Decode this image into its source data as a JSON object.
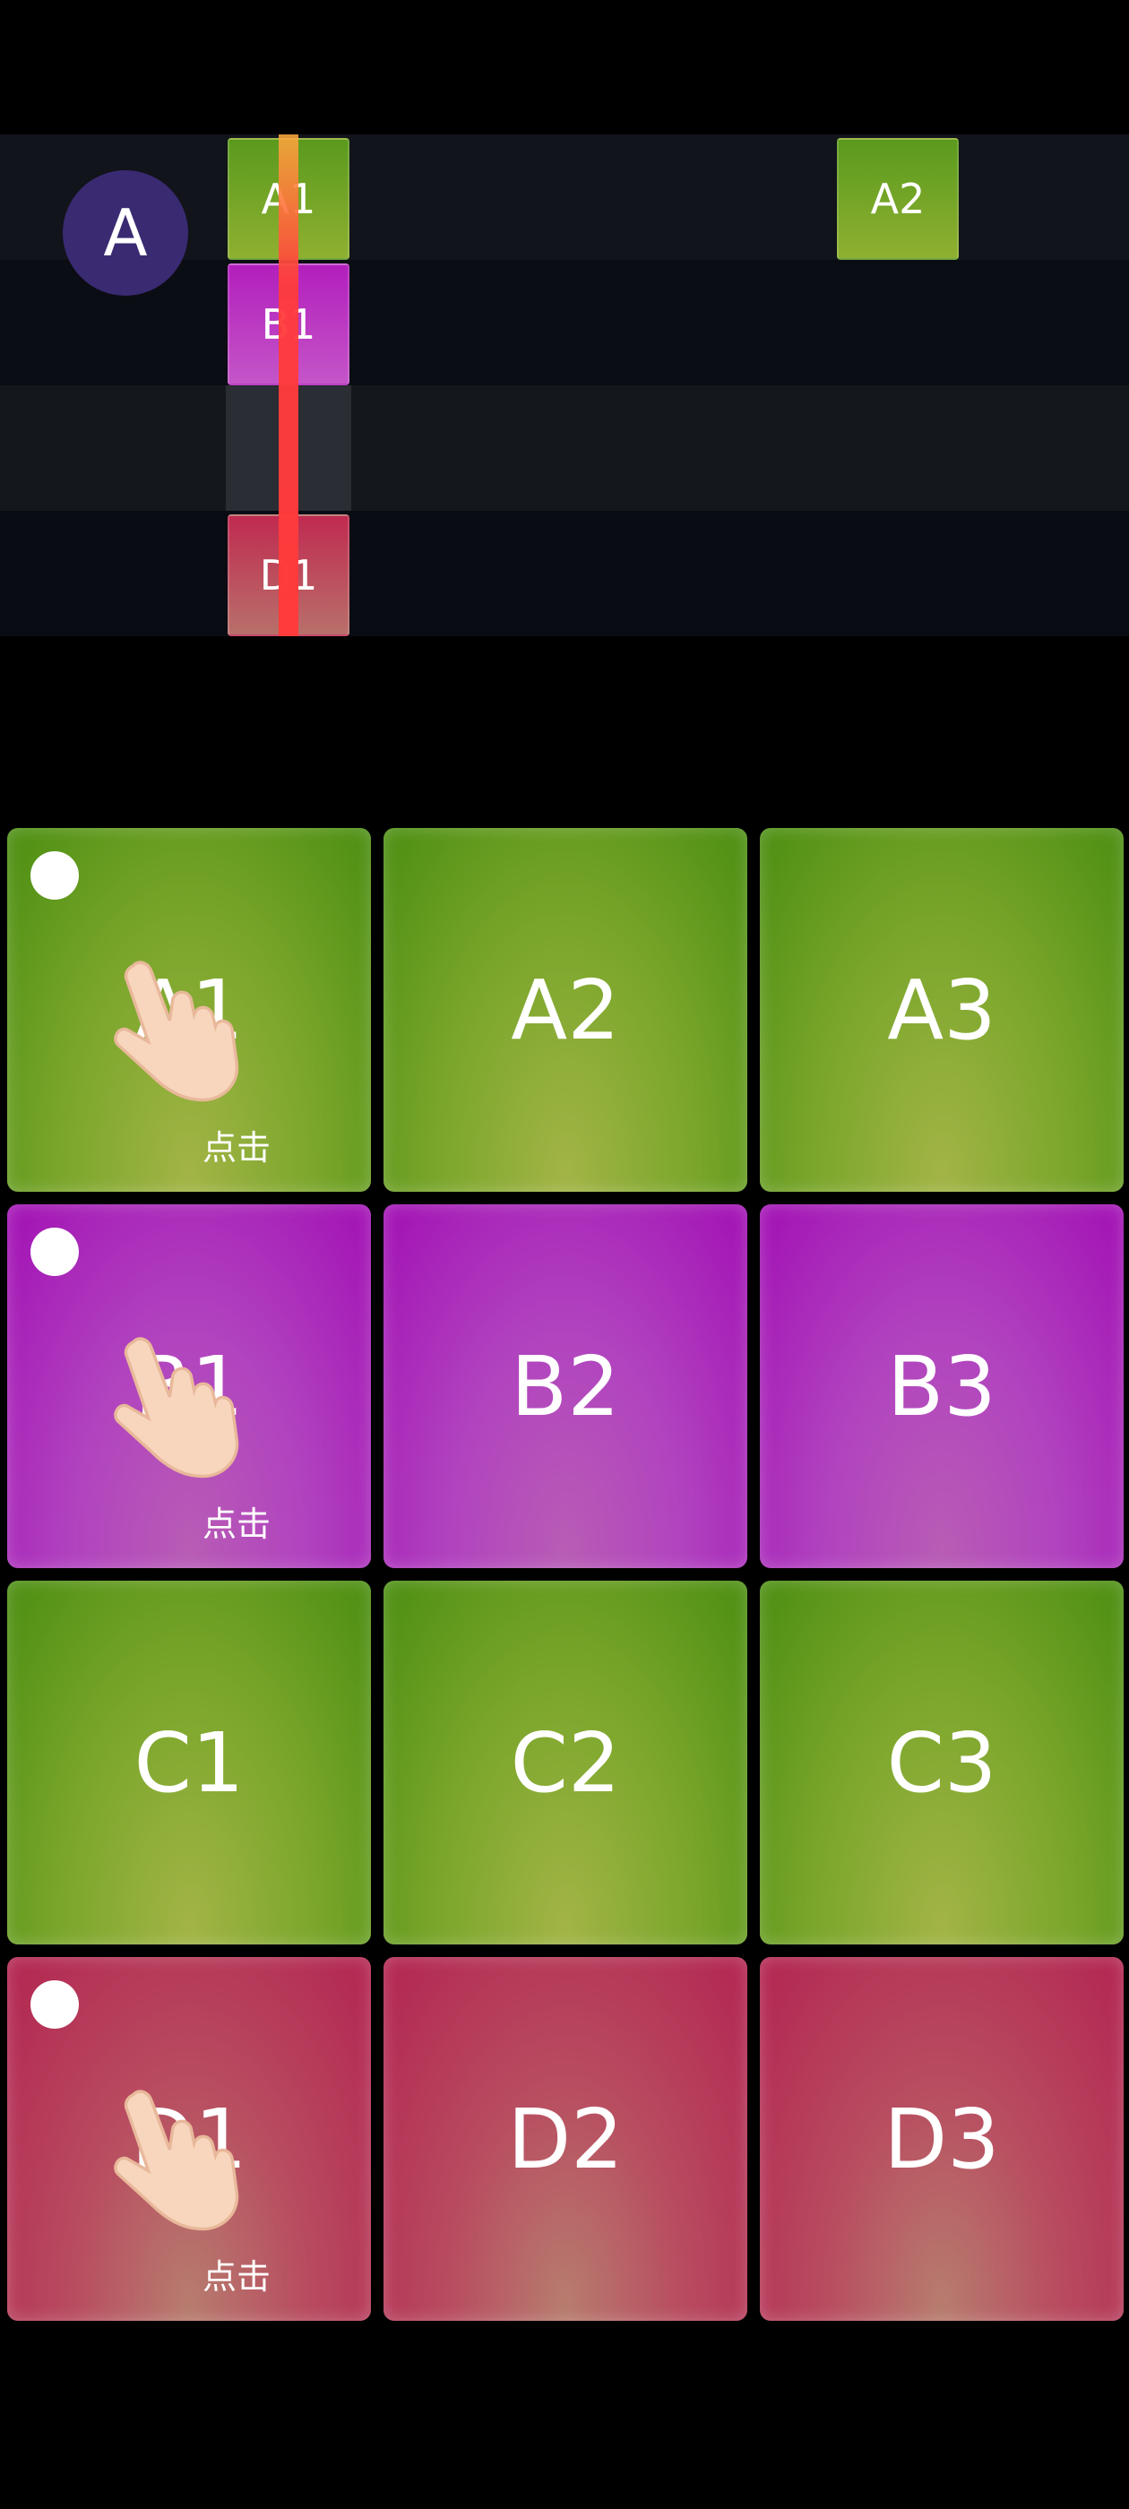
{
  "timeline": {
    "track_avatar": "A",
    "clips": [
      {
        "label": "A1",
        "color": "green"
      },
      {
        "label": "B1",
        "color": "purple"
      },
      {
        "label": "D1",
        "color": "red"
      },
      {
        "label": "A2",
        "color": "green"
      }
    ]
  },
  "pads": [
    {
      "label": "A1",
      "color": "green",
      "tutorial": true,
      "tap_text": "点击"
    },
    {
      "label": "A2",
      "color": "green"
    },
    {
      "label": "A3",
      "color": "green"
    },
    {
      "label": "B1",
      "color": "purple",
      "tutorial": true,
      "tap_text": "点击"
    },
    {
      "label": "B2",
      "color": "purple"
    },
    {
      "label": "B3",
      "color": "purple"
    },
    {
      "label": "C1",
      "color": "green"
    },
    {
      "label": "C2",
      "color": "green"
    },
    {
      "label": "C3",
      "color": "green"
    },
    {
      "label": "D1",
      "color": "red",
      "tutorial": true,
      "tap_text": "点击"
    },
    {
      "label": "D2",
      "color": "red"
    },
    {
      "label": "D3",
      "color": "red"
    }
  ],
  "colors": {
    "green": "#6aa02a",
    "purple": "#b02fc0",
    "red": "#b8304f",
    "playhead": "#ff3b3b",
    "avatar": "#3a2a72"
  },
  "icons": [
    "hand-tap-icon"
  ]
}
